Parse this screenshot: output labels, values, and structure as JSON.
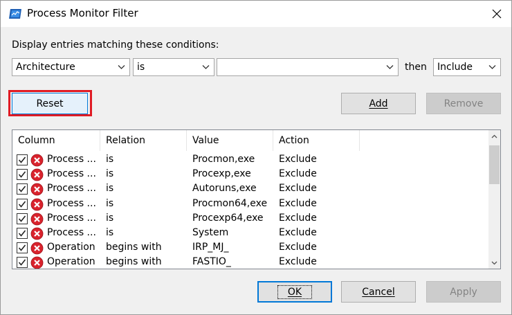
{
  "window": {
    "title": "Process Monitor Filter"
  },
  "conditions": {
    "label": "Display entries matching these conditions:",
    "column_value": "Architecture",
    "relation_value": "is",
    "value_value": "",
    "then_label": "then",
    "action_value": "Include"
  },
  "buttons": {
    "reset": "Reset",
    "add": "Add",
    "remove": "Remove",
    "ok": "OK",
    "cancel": "Cancel",
    "apply": "Apply"
  },
  "table": {
    "headers": [
      "Column",
      "Relation",
      "Value",
      "Action"
    ],
    "rows": [
      {
        "column": "Process ...",
        "relation": "is",
        "value": "Procmon,exe",
        "action": "Exclude",
        "checked": true
      },
      {
        "column": "Process ...",
        "relation": "is",
        "value": "Procexp,exe",
        "action": "Exclude",
        "checked": true
      },
      {
        "column": "Process ...",
        "relation": "is",
        "value": "Autoruns,exe",
        "action": "Exclude",
        "checked": true
      },
      {
        "column": "Process ...",
        "relation": "is",
        "value": "Procmon64,exe",
        "action": "Exclude",
        "checked": true
      },
      {
        "column": "Process ...",
        "relation": "is",
        "value": "Procexp64,exe",
        "action": "Exclude",
        "checked": true
      },
      {
        "column": "Process ...",
        "relation": "is",
        "value": "System",
        "action": "Exclude",
        "checked": true
      },
      {
        "column": "Operation",
        "relation": "begins with",
        "value": "IRP_MJ_",
        "action": "Exclude",
        "checked": true
      },
      {
        "column": "Operation",
        "relation": "begins with",
        "value": "FASTIO_",
        "action": "Exclude",
        "checked": true
      }
    ]
  },
  "colors": {
    "highlight": "#e01b24",
    "focus": "#0078d7",
    "exclude_icon": "#d9232d"
  },
  "icons": {
    "app": "process-monitor-icon",
    "close": "close-icon",
    "row": "exclude-x-icon"
  }
}
